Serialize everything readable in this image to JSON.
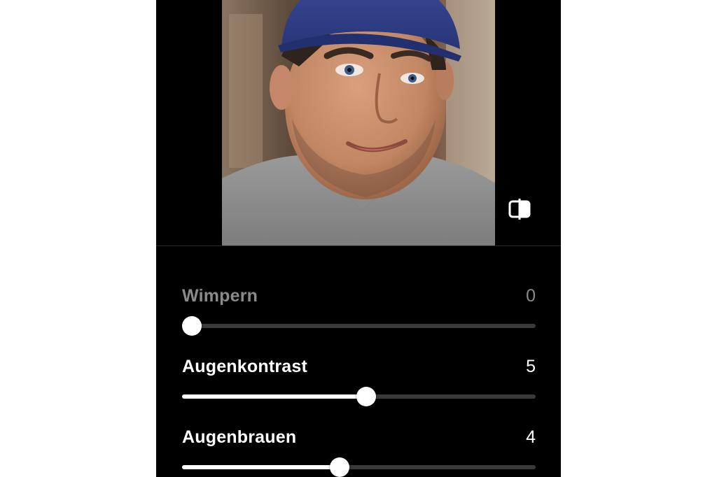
{
  "photo": {
    "alt": "Portrait photo",
    "icon": "compare-icon"
  },
  "sliders": [
    {
      "label": "Wimpern",
      "value": "0",
      "level": 0.0,
      "dim": true
    },
    {
      "label": "Augenkontrast",
      "value": "5",
      "level": 0.52,
      "dim": false
    },
    {
      "label": "Augenbrauen",
      "value": "4",
      "level": 0.445,
      "dim": false
    }
  ],
  "colors": {
    "background": "#000000",
    "track": "#3a3a3a",
    "fill": "#ffffff",
    "dim_text": "#8a8a8a",
    "cap": "#2f3f8c"
  }
}
